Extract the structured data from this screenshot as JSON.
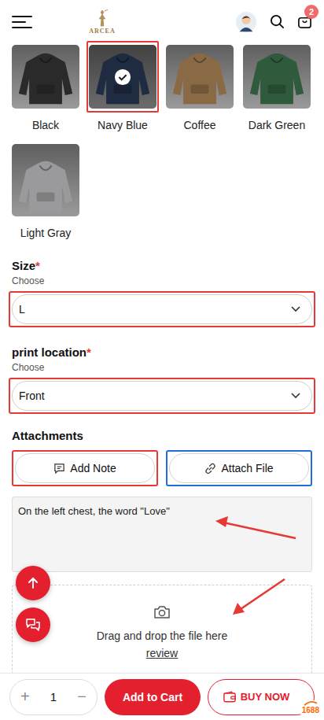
{
  "header": {
    "logo": "ARCEA",
    "cart_count": "2"
  },
  "colors": [
    {
      "label": "Black",
      "selected": false,
      "color": "#2a2a2a",
      "highlight": null
    },
    {
      "label": "Navy Blue",
      "selected": true,
      "color": "#2c3e5c",
      "highlight": "#e53935"
    },
    {
      "label": "Coffee",
      "selected": false,
      "color": "#8a6a45",
      "highlight": null
    },
    {
      "label": "Dark Green",
      "selected": false,
      "color": "#2f5a3c",
      "highlight": null
    },
    {
      "label": "Light Gray",
      "selected": false,
      "color": "#9a9a9c",
      "highlight": null
    }
  ],
  "fields": [
    {
      "label": "Size",
      "required_mark": "*",
      "hint": "Choose",
      "value": "L",
      "highlight": "#e53935"
    },
    {
      "label": "print location",
      "required_mark": "*",
      "hint": "Choose",
      "value": "Front",
      "highlight": "#e53935"
    }
  ],
  "attachments": {
    "title": "Attachments",
    "buttons": [
      {
        "label": "Add Note",
        "kind": "note",
        "highlight": "#e53935"
      },
      {
        "label": "Attach File",
        "kind": "file",
        "highlight": "#1e6fd9"
      }
    ],
    "note": "On the left chest, the word \"Love\"",
    "dropzone": {
      "text": "Drag and drop the file here",
      "link": "review"
    }
  },
  "bottom_bar": {
    "plus": "+",
    "quantity": "1",
    "minus": "−",
    "add_to_cart": "Add to Cart",
    "buy_now": "BUY NOW",
    "badge": "1688"
  }
}
